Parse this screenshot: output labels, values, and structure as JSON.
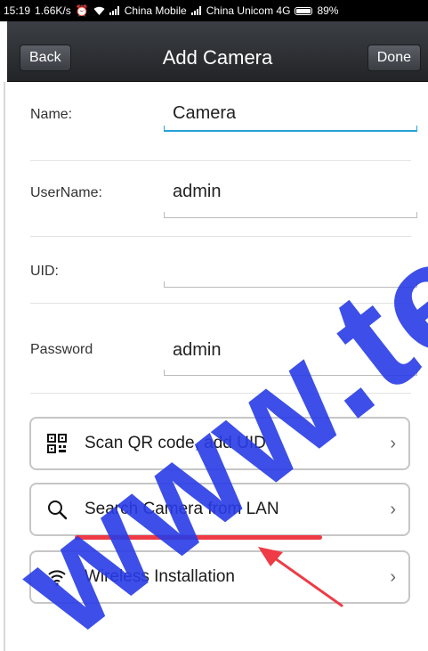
{
  "status_bar": {
    "time": "15:19",
    "speed": "1.66K/s",
    "carrier1": "China Mobile",
    "carrier2": "China Unicom 4G",
    "battery": "89%"
  },
  "nav": {
    "back_label": "Back",
    "title": "Add Camera",
    "done_label": "Done"
  },
  "form": {
    "name_label": "Name:",
    "name_value": "Camera",
    "username_label": "UserName:",
    "username_value": "admin",
    "uid_label": "UID:",
    "uid_value": "",
    "password_label": "Password",
    "password_value": "admin"
  },
  "options": [
    {
      "label": "Scan QR code, add UID",
      "icon": "qr-code-icon"
    },
    {
      "label": "Search Camera from LAN",
      "icon": "search-icon"
    },
    {
      "label": "Wireless Installation",
      "icon": "wifi-icon"
    }
  ],
  "watermark": "www.tech",
  "colors": {
    "nav_bg": "#2e3135",
    "focus_underline": "#2aa3d6",
    "highlight": "#ee3b45",
    "watermark": "#283ce6"
  }
}
